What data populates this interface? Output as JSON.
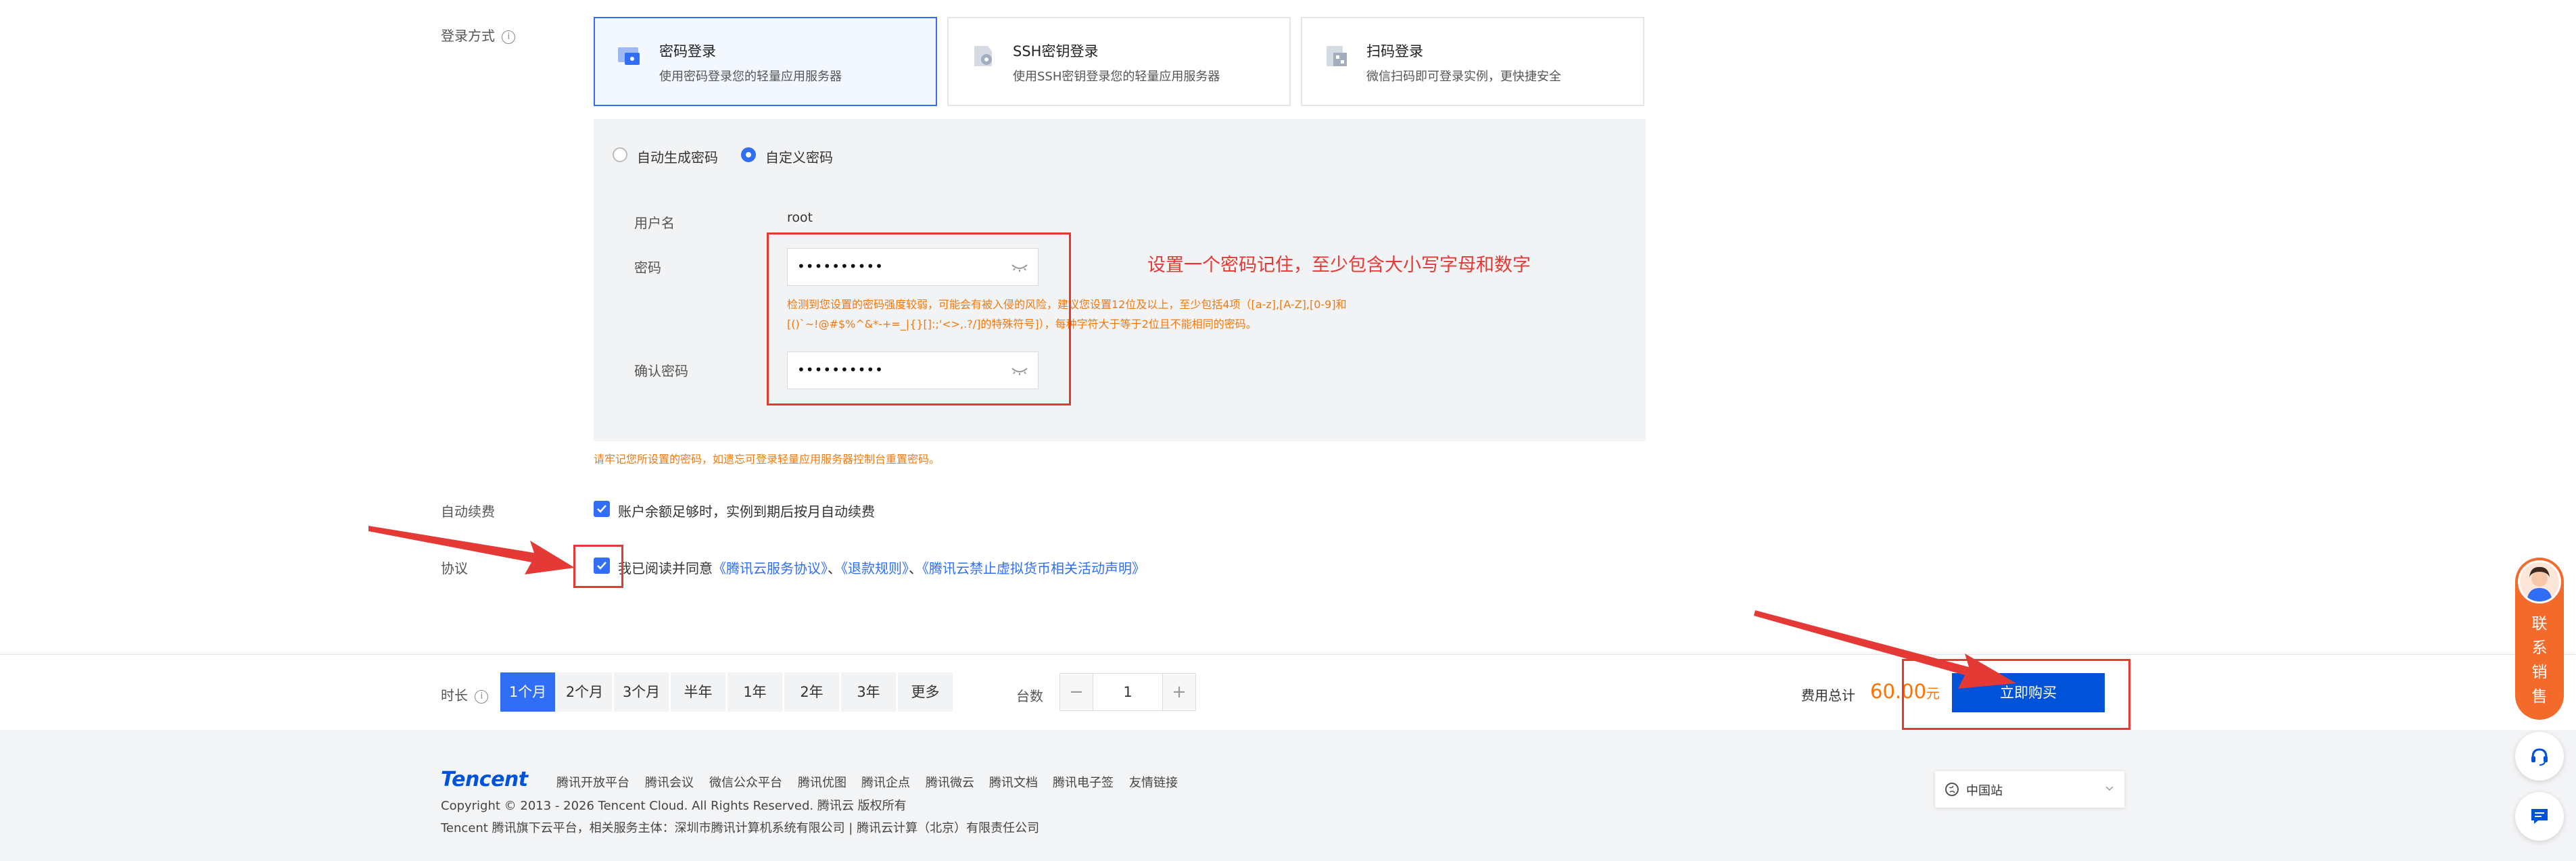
{
  "login": {
    "label": "登录方式",
    "cards": [
      {
        "title": "密码登录",
        "desc": "使用密码登录您的轻量应用服务器",
        "selected": true
      },
      {
        "title": "SSH密钥登录",
        "desc": "使用SSH密钥登录您的轻量应用服务器",
        "selected": false
      },
      {
        "title": "扫码登录",
        "desc": "微信扫码即可登录实例，更快捷安全",
        "selected": false
      }
    ]
  },
  "password": {
    "options": [
      {
        "label": "自动生成密码",
        "selected": false
      },
      {
        "label": "自定义密码",
        "selected": true
      }
    ],
    "username_label": "用户名",
    "username_value": "root",
    "password_label": "密码",
    "password_value": "••••••••••",
    "confirm_label": "确认密码",
    "confirm_value": "••••••••••",
    "warning_line1": "检测到您设置的密码强度较弱，可能会有被入侵的风险，建议您设置12位及以上，至少包括4项（[a-z],[A-Z],[0-9]和",
    "warning_line2": "[()`~!@#$%^&*-+=_|{}[]:;'<>,.?/]的特殊符号]），每种字符大于等于2位且不能相同的密码。",
    "annotation": "设置一个密码记住，至少包含大小写字母和数字",
    "remember_note": "请牢记您所设置的密码，如遗忘可登录轻量应用服务器控制台重置密码。"
  },
  "renew": {
    "label": "自动续费",
    "checkbox_text": "账户余额足够时，实例到期后按月自动续费",
    "checked": true
  },
  "agreement": {
    "label": "协议",
    "prefix": "我已阅读并同意",
    "link1": "《腾讯云服务协议》",
    "sep1": "、",
    "link2": "《退款规则》",
    "sep2": "、",
    "link3": "《腾讯云禁止虚拟货币相关活动声明》",
    "checked": true
  },
  "purchase": {
    "duration_label": "时长",
    "durations": [
      "1个月",
      "2个月",
      "3个月",
      "半年",
      "1年",
      "2年",
      "3年",
      "更多"
    ],
    "selected_duration": "1个月",
    "quantity_label": "台数",
    "quantity": "1",
    "minus": "−",
    "plus": "+",
    "total_label": "费用总计",
    "price": "60.00",
    "currency": "元",
    "buy_label": "立即购买"
  },
  "footer": {
    "logo": "Tencent",
    "links": [
      "腾讯开放平台",
      "腾讯会议",
      "微信公众平台",
      "腾讯优图",
      "腾讯企点",
      "腾讯微云",
      "腾讯文档",
      "腾讯电子签",
      "友情链接"
    ],
    "copyright": "Copyright © 2013 - 2026 Tencent Cloud. All Rights Reserved. 腾讯云 版权所有",
    "entity": "Tencent 腾讯旗下云平台，相关服务主体：深圳市腾讯计算机系统有限公司 | 腾讯云计算（北京）有限责任公司",
    "region": "中国站"
  },
  "sidebar": {
    "sales_text": [
      "联",
      "系",
      "销",
      "售"
    ]
  },
  "colors": {
    "accent": "#2f6ef5",
    "buy_button": "#0052d9",
    "price": "#ff7200",
    "warning": "#f0790f",
    "annotation_red": "#e53935",
    "sales_orange": "#f46a2b"
  }
}
